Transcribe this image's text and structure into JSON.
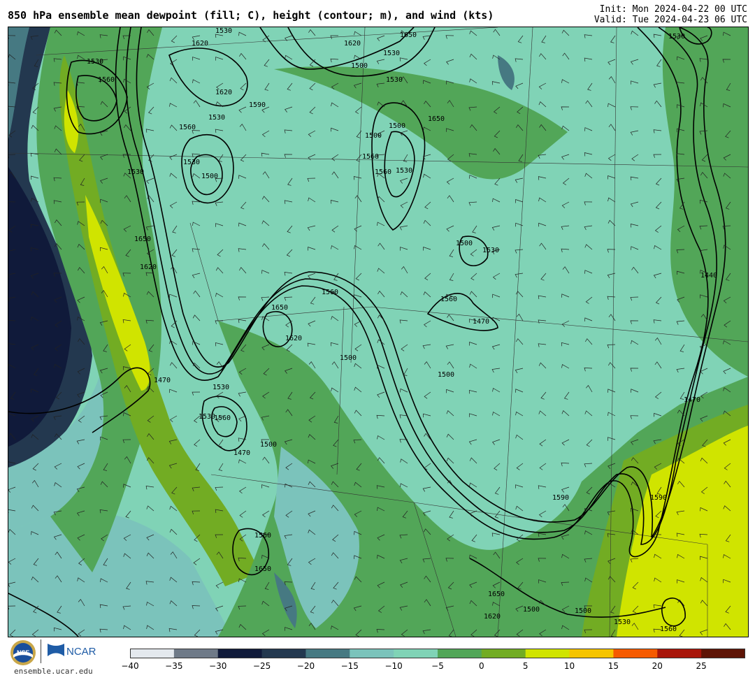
{
  "header": {
    "title": "850 hPa ensemble mean dewpoint (fill; C), height (contour; m), and wind (kts)",
    "init": "Init: Mon 2024-04-22 00 UTC",
    "valid": "Valid: Tue 2024-04-23 06 UTC"
  },
  "footer": {
    "nsf_logo_text": "NSF",
    "ncar_logo_text": "NCAR",
    "site": "ensemble.ucar.edu"
  },
  "colorbar": {
    "ticks": [
      "−40",
      "−35",
      "−30",
      "−25",
      "−20",
      "−15",
      "−10",
      "−5",
      "0",
      "5",
      "10",
      "15",
      "20",
      "25"
    ],
    "colors": [
      "#e4e9ee",
      "#6f7a88",
      "#101a3a",
      "#23384f",
      "#467982",
      "#7bc3bb",
      "#80d3b6",
      "#52a658",
      "#72ac23",
      "#d0e400",
      "#f5c400",
      "#f55a00",
      "#a8150a",
      "#5e1406"
    ]
  },
  "map_contour_labels": [
    "1530",
    "1560",
    "1620",
    "1530",
    "1560",
    "1530",
    "1590",
    "1620",
    "1500",
    "1530",
    "1620",
    "1650",
    "1530",
    "1500",
    "1500",
    "1530",
    "1560",
    "1650",
    "1560",
    "1530",
    "1500",
    "1530",
    "1650",
    "1620",
    "1650",
    "1620",
    "1560",
    "1500",
    "1530",
    "1560",
    "1470",
    "1500",
    "1470",
    "1530",
    "1560",
    "1500",
    "1530",
    "1500",
    "1470",
    "1560",
    "1650",
    "1590",
    "1650",
    "1620",
    "1500",
    "1500",
    "1530",
    "1560",
    "1530",
    "1440",
    "1470",
    "1590"
  ],
  "map_colors": {
    "very_dry": "#101a3a",
    "dry": "#23384f",
    "teal_dark": "#467982",
    "teal": "#7bc3bb",
    "mint": "#80d3b6",
    "green": "#52a658",
    "olive": "#72ac23",
    "yellow": "#d0e400"
  }
}
